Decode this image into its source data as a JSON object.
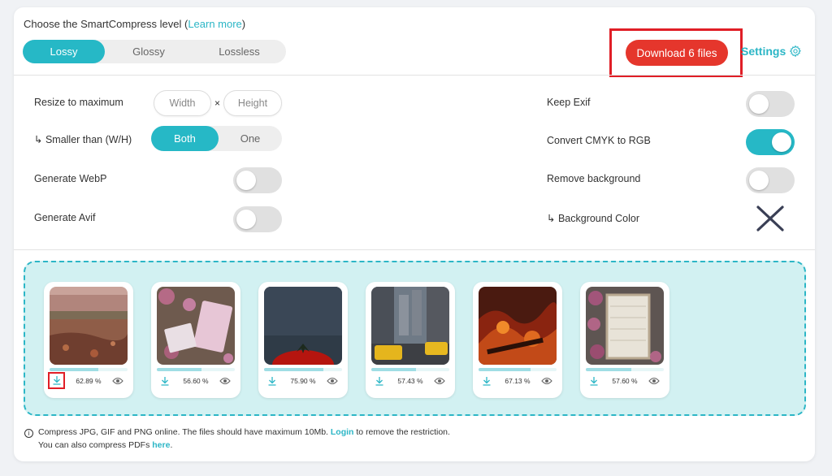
{
  "header": {
    "level_title_prefix": "Choose the SmartCompress level (",
    "learn_more": "Learn more",
    "level_title_suffix": ")",
    "levels": [
      "Lossy",
      "Glossy",
      "Lossless"
    ],
    "selected_level": "Lossy",
    "download_label": "Download 6 files",
    "settings_label": "Settings"
  },
  "settings": {
    "resize_label": "Resize to maximum",
    "width_placeholder": "Width",
    "height_placeholder": "Height",
    "times": "×",
    "smaller_label": "↳ Smaller than (W/H)",
    "smaller_options": [
      "Both",
      "One"
    ],
    "smaller_selected": "Both",
    "webp_label": "Generate WebP",
    "webp_on": false,
    "avif_label": "Generate Avif",
    "avif_on": false,
    "exif_label": "Keep Exif",
    "exif_on": false,
    "cmyk_label": "Convert CMYK to RGB",
    "cmyk_on": true,
    "removebg_label": "Remove background",
    "removebg_on": false,
    "bgcolor_label": "↳ Background Color"
  },
  "files": [
    {
      "percent": "62.89 %",
      "progress": 0.63,
      "icon": "autumn-park-image"
    },
    {
      "percent": "56.60 %",
      "progress": 0.57,
      "icon": "notebook-flowers-image"
    },
    {
      "percent": "75.90 %",
      "progress": 0.76,
      "icon": "tomato-dark-image"
    },
    {
      "percent": "57.43 %",
      "progress": 0.57,
      "icon": "city-taxis-image"
    },
    {
      "percent": "67.13 %",
      "progress": 0.67,
      "icon": "bonfire-image"
    },
    {
      "percent": "57.60 %",
      "progress": 0.58,
      "icon": "frame-flowers-image"
    }
  ],
  "footer": {
    "line1_text": "Compress JPG, GIF and PNG online. The files should have maximum 10Mb.",
    "login": "Login",
    "line1_suffix": "to remove the restriction.",
    "line2_text": "You can also compress PDFs",
    "here": "here",
    "line2_suffix": "."
  },
  "colors": {
    "accent": "#26b8c6",
    "download": "#e5362c",
    "highlight_box": "#e01e26",
    "dropzone_bg": "#d2f1f2"
  }
}
